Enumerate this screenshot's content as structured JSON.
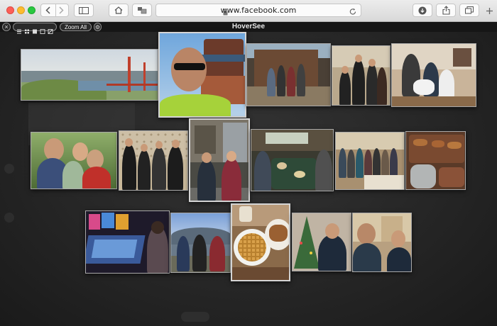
{
  "browser": {
    "url": "www.facebook.com",
    "icons": {
      "back": "chevron-left-icon",
      "forward": "chevron-right-icon",
      "sidebar": "sidebar-icon",
      "home": "home-icon",
      "extension": "hoversee-extension-icon",
      "lock": "lock-icon",
      "reload": "reload-icon",
      "downloads": "download-icon",
      "share": "share-icon",
      "tabs": "tabs-icon",
      "new_tab": "plus-icon"
    }
  },
  "overlay": {
    "title": "HoverSee",
    "close_label": "×",
    "zoom_label": "Zoom All",
    "gear_label": "⚙",
    "view_modes": [
      "list-view-icon",
      "small-grid-icon",
      "medium-grid-icon",
      "large-grid-icon",
      "fit-icon"
    ]
  },
  "photos": [
    {
      "name": "photo-golden-gate-bridge"
    },
    {
      "name": "photo-selfie-temple"
    },
    {
      "name": "photo-group-cabin"
    },
    {
      "name": "photo-family-living-room"
    },
    {
      "name": "photo-family-with-dog"
    },
    {
      "name": "photo-family-hug"
    },
    {
      "name": "photo-family-formal"
    },
    {
      "name": "photo-street-pair"
    },
    {
      "name": "photo-dinner-table"
    },
    {
      "name": "photo-group-party"
    },
    {
      "name": "photo-food-platter"
    },
    {
      "name": "photo-pinball-arcade"
    },
    {
      "name": "photo-mountain-group"
    },
    {
      "name": "photo-waffles"
    },
    {
      "name": "photo-christmas-tree"
    },
    {
      "name": "photo-father-son-selfie"
    }
  ],
  "colors": {
    "toolbar": "#e4e4e4",
    "overlay_bg": "#1b1b1c",
    "title_text": "#e8e8e8"
  }
}
